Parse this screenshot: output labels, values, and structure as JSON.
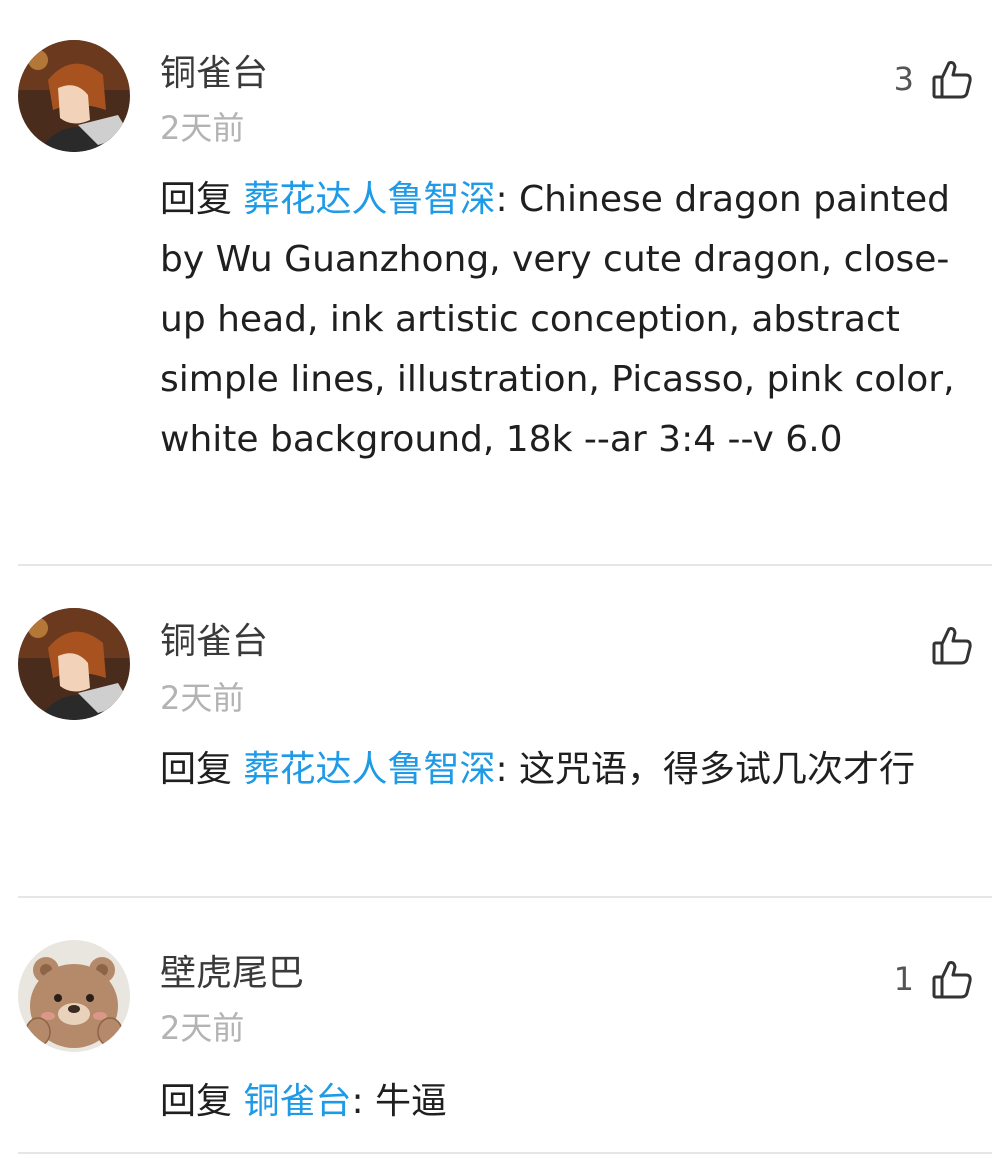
{
  "comments": [
    {
      "username": "铜雀台",
      "time": "2天前",
      "like_count": "3",
      "reply_prefix": "回复 ",
      "reply_target": "葬花达人鲁智深",
      "separator": ": ",
      "text": "Chinese dragon painted by Wu Guanzhong, very cute dragon, close-up head, ink artistic conception, abstract simple lines, illustration, Picasso, pink color, white background, 18k --ar 3:4 --v 6.0",
      "avatar_icon": "anime-boy-avatar"
    },
    {
      "username": "铜雀台",
      "time": "2天前",
      "like_count": "",
      "reply_prefix": "回复 ",
      "reply_target": "葬花达人鲁智深",
      "separator": ": ",
      "text": "这咒语，得多试几次才行",
      "avatar_icon": "anime-boy-avatar"
    },
    {
      "username": "壁虎尾巴",
      "time": "2天前",
      "like_count": "1",
      "reply_prefix": "回复 ",
      "reply_target": "铜雀台",
      "separator": ": ",
      "text": "牛逼",
      "avatar_icon": "bear-avatar"
    }
  ],
  "icons": {
    "like": "thumbs-up-outline-icon"
  },
  "colors": {
    "link": "#1e9ae6",
    "meta": "#b3b3b3",
    "divider": "#e6e6e6"
  }
}
